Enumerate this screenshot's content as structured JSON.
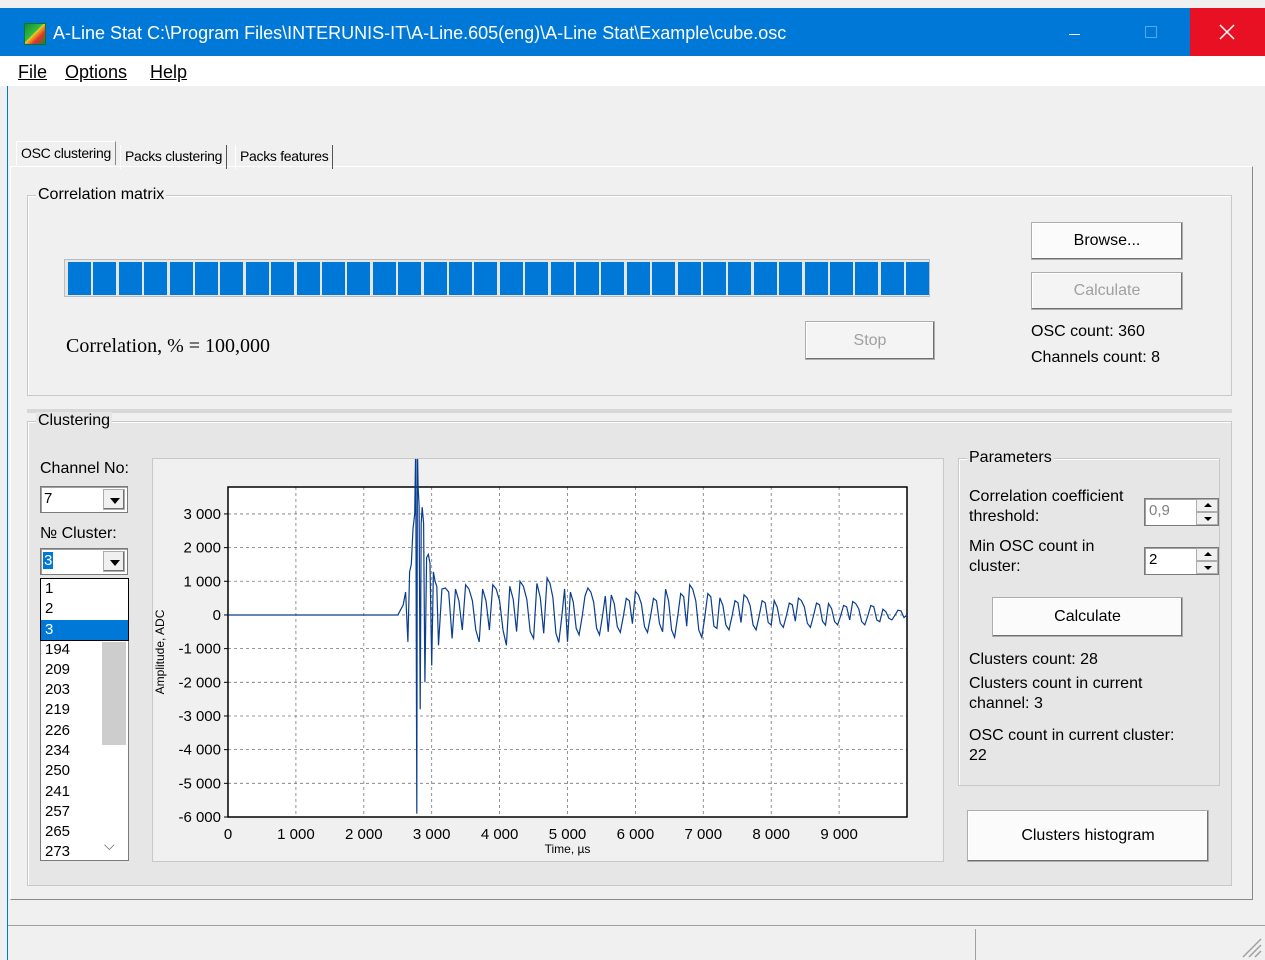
{
  "window": {
    "title": "A-Line Stat   C:\\Program Files\\INTERUNIS-IT\\A-Line.605(eng)\\A-Line Stat\\Example\\cube.osc"
  },
  "menu": {
    "file": "File",
    "options": "Options",
    "help": "Help"
  },
  "tabs": [
    "OSC clustering",
    "Packs clustering",
    "Packs features"
  ],
  "correlation": {
    "group_label": "Correlation matrix",
    "progress_percent": 100,
    "correlation_text": "Correlation, % = 100,000",
    "browse_label": "Browse...",
    "calculate_label": "Calculate",
    "stop_label": "Stop",
    "osc_count": "OSC count: 360",
    "channels_count": "Channels count: 8"
  },
  "clustering": {
    "group_label": "Clustering",
    "channel_label": "Channel No:",
    "channel_value": "7",
    "cluster_label": "№ Cluster:",
    "cluster_value": "3",
    "dropdown_options": [
      "1",
      "2",
      "3"
    ],
    "dropdown_selected": "3",
    "list_items": [
      "194",
      "209",
      "203",
      "219",
      "226",
      "234",
      "250",
      "241",
      "257",
      "265",
      "273"
    ],
    "parameters": {
      "group_label": "Parameters",
      "corr_threshold_label": "Correlation coefficient threshold:",
      "corr_threshold_value": "0,9",
      "min_osc_label": "Min OSC count in cluster:",
      "min_osc_value": "2",
      "calculate_label": "Calculate",
      "clusters_count": "Clusters count: 28",
      "clusters_current": "Clusters count in current channel: 3",
      "osc_current": "OSC count in current cluster: 22"
    },
    "histogram_label": "Clusters histogram"
  },
  "chart_data": {
    "type": "line",
    "xlabel": "Time, µs",
    "ylabel": "Amplitude, ADC",
    "xlim": [
      0,
      10000
    ],
    "ylim": [
      -6000,
      3800
    ],
    "x_ticks": [
      "0",
      "1 000",
      "2 000",
      "3 000",
      "4 000",
      "5 000",
      "6 000",
      "7 000",
      "8 000",
      "9 000"
    ],
    "y_ticks": [
      "3 000",
      "2 000",
      "1 000",
      "0",
      "-1 000",
      "-2 000",
      "-3 000",
      "-4 000",
      "-5 000",
      "-6 000"
    ],
    "grid": true,
    "line_color": "#0a3d8f",
    "series": [
      {
        "x": [
          0,
          2500,
          2580,
          2650,
          2700,
          2750,
          2780,
          2800,
          2830,
          2860,
          2900,
          2950,
          3000,
          3050,
          3100,
          3200,
          3300,
          3500,
          3700,
          3900,
          4100,
          4300,
          4500,
          4700,
          5000,
          5300,
          5600,
          6000,
          6400,
          6800,
          7200,
          7600,
          8000,
          8400,
          8800,
          9200,
          9600,
          10000
        ],
        "y": [
          0,
          0,
          300,
          -800,
          1500,
          3000,
          -5900,
          3800,
          -2800,
          3200,
          -2000,
          1800,
          -1500,
          1000,
          -900,
          800,
          -700,
          900,
          -800,
          900,
          -900,
          1000,
          -700,
          1100,
          -800,
          800,
          -500,
          700,
          -500,
          900,
          -400,
          600,
          -300,
          500,
          -300,
          400,
          -200,
          0
        ]
      }
    ]
  }
}
